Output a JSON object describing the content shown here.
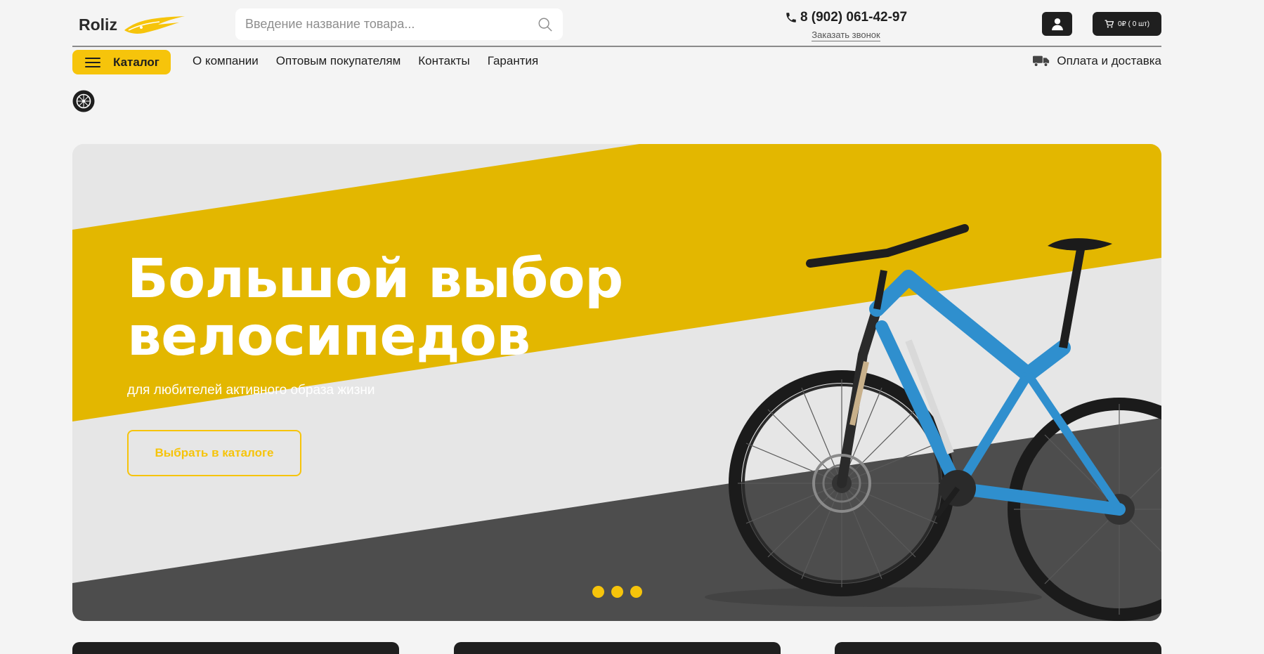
{
  "header": {
    "logo_text": "Roliz",
    "search": {
      "placeholder": "Введение название товара..."
    },
    "phone": "8 (902) 061-42-97",
    "callback_label": "Заказать звонок",
    "cart_label": "0₽ ( 0 шт)"
  },
  "nav": {
    "catalog_label": "Каталог",
    "links": [
      "О компании",
      "Оптовым покупателям",
      "Контакты",
      "Гарантия"
    ],
    "delivery_label": "Оплата и доставка"
  },
  "hero": {
    "title_line1": "Большой выбор",
    "title_line2": "велосипедов",
    "subtitle": "для любителей активного образа жизни",
    "cta_label": "Выбрать в каталоге",
    "slides_count": 3
  },
  "colors": {
    "accent": "#f6c40b",
    "dark": "#1f1f1f",
    "page_bg": "#f4f4f4",
    "hero_yellow": "#e3b700",
    "hero_dark": "#4d4d4d"
  },
  "icons": {
    "search": "search-icon",
    "phone": "phone-icon",
    "user": "user-icon",
    "cart": "cart-icon",
    "truck": "truck-icon",
    "menu": "hamburger-icon",
    "wheel": "wheel-icon"
  }
}
